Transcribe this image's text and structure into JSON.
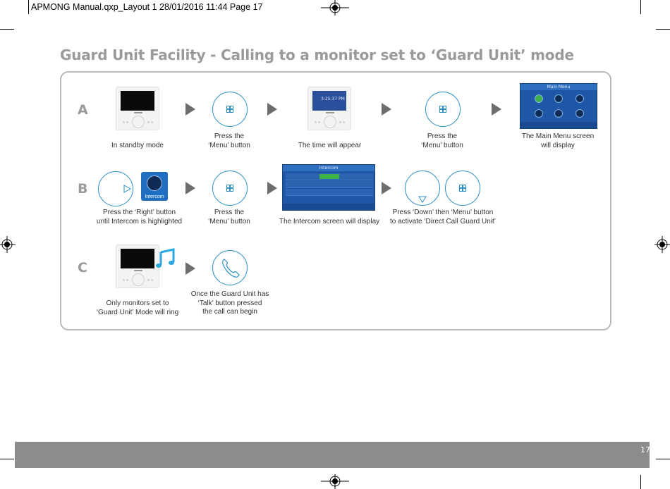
{
  "print_header": "APMONG Manual.qxp_Layout 1  28/01/2016  11:44  Page 17",
  "title": "Guard Unit Facility - Calling to a monitor set to ‘Guard Unit’ mode",
  "rows": {
    "a": {
      "letter": "A",
      "captions": [
        "In standby mode",
        "Press the",
        "‘Menu’ button",
        "The time will appear",
        "Press the",
        "‘Menu’ button",
        "The Main Menu screen",
        "will display"
      ]
    },
    "b": {
      "letter": "B",
      "captions": [
        "Press the ‘Right’ button",
        "until Intercom is highlighted",
        "Press the",
        "‘Menu’ button",
        "The Intercom screen will display",
        "Press ‘Down’ then ‘Menu’ button",
        "to activate ‘Direct Call Guard Unit’"
      ]
    },
    "c": {
      "letter": "C",
      "captions": [
        "Only monitors set to",
        "‘Guard Unit’ Mode will ring",
        "Once the Guard Unit has",
        "‘Talk’ button pressed",
        "the  call can begin"
      ]
    }
  },
  "screens": {
    "time_text": "3:25:37 PM",
    "main_menu_title": "Main Menu",
    "intercom_title": "Intercom",
    "intercom_badge": "Intercom"
  },
  "icons": {
    "menu": "menu-grid-icon",
    "right": "right-triangle-icon",
    "down": "down-triangle-icon",
    "talk": "phone-handset-icon",
    "music": "music-note-icon",
    "arrow": "step-arrow-icon"
  },
  "colors": {
    "accent": "#2a8fc7",
    "title": "#9a9a9a",
    "footer": "#8c8c8c"
  },
  "page_number": "17"
}
